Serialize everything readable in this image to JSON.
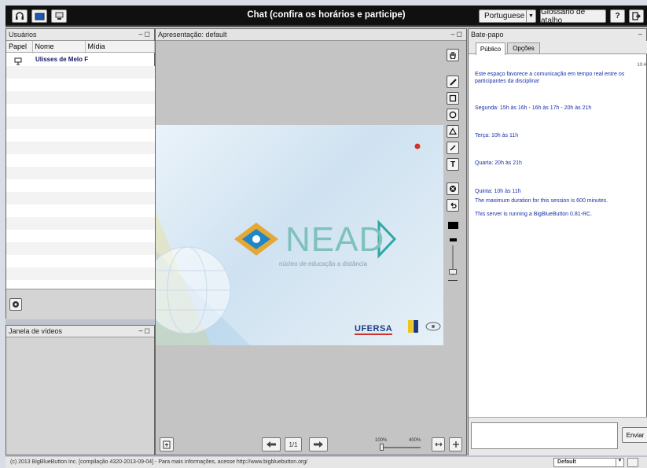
{
  "topbar": {
    "title": "Chat (confira os horários e participe)",
    "language": "Portuguese",
    "shortcuts": "Glossário de atalho",
    "help": "?",
    "icons": [
      "headset-icon",
      "webcam-icon",
      "desktop-share-icon"
    ]
  },
  "users": {
    "title": "Usuários",
    "columns": [
      "Papel",
      "Nome",
      "Mídia"
    ],
    "rows": [
      {
        "name": "Ulisses  de Melo F"
      }
    ]
  },
  "video": {
    "title": "Janela de vídeos"
  },
  "presentation": {
    "title": "Apresentação: default",
    "slide": {
      "brand": "NEAD",
      "subtitle": "núcleo de educação a distância",
      "logo": "UFERSA"
    },
    "page": "1/1",
    "zoom_min": "100%",
    "zoom_max": "400%"
  },
  "chat": {
    "title": "Bate-papo",
    "tabs": [
      "Público",
      "Opções"
    ],
    "time": "10:4",
    "messages": [
      "Este espaço favorece a comunicação em tempo real entre os participantes da disciplina!",
      "Segunda: 15h às 16h - 16h às 17h - 20h às 21h",
      "Terça: 10h às 11h",
      "Quarta: 20h às 21h",
      "Quinta: 10h às 11h",
      "The maximum duration for this session is 600 minutes.",
      "This server is running a BigBlueButton 0.81-RC."
    ],
    "send": "Enviar"
  },
  "footer": {
    "copyright": "(c) 2013 BigBlueButton Inc. [compilação 4320-2013-09-04] - Para mais informações, acesse http://www.bigbluebutton.org/",
    "layout": "Default"
  },
  "colors": {
    "topbar": "#101010",
    "chat_text": "#1a2fa6",
    "accent_red": "#d0332b"
  }
}
